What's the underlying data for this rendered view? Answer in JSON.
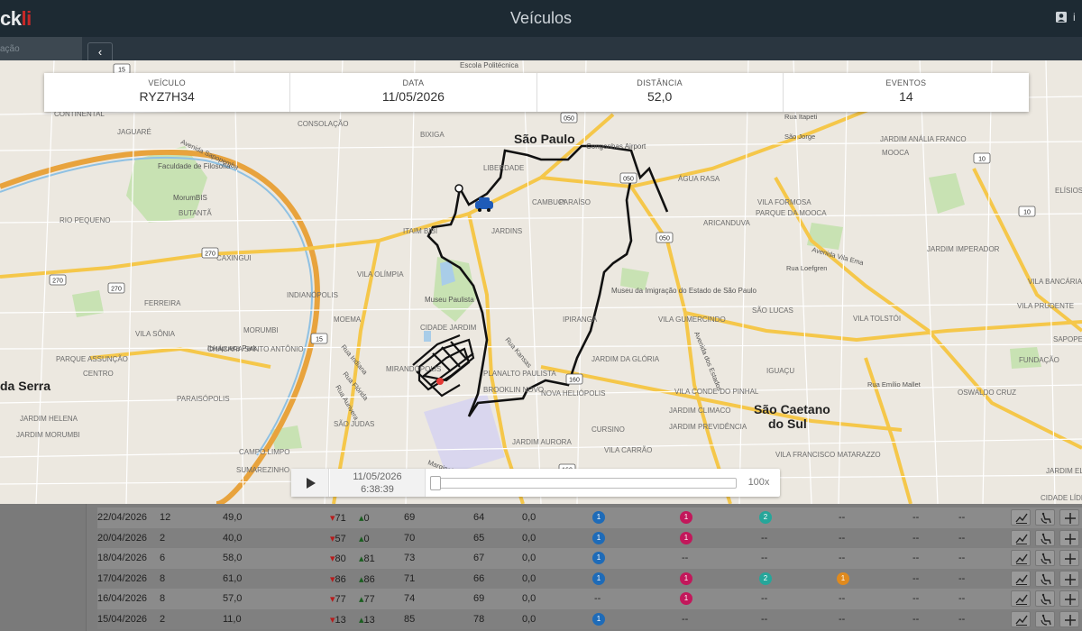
{
  "app": {
    "logo_prefix": "ck",
    "logo_accent": "li",
    "title": "Veículos",
    "user": "i"
  },
  "sidebar": {
    "search_placeholder": "ação"
  },
  "info": [
    {
      "label": "Veículo",
      "value": "RYZ7H34"
    },
    {
      "label": "Data",
      "value": "11/05/2026"
    },
    {
      "label": "Distância",
      "value": "52,0"
    },
    {
      "label": "Eventos",
      "value": "14"
    }
  ],
  "playback": {
    "date": "11/05/2026",
    "time": "6:38:39",
    "speed": "100x",
    "progress": 0
  },
  "map": {
    "labels": [
      {
        "t": "São Paulo",
        "k": "city"
      },
      {
        "t": "São Caetano",
        "k": "city"
      },
      {
        "t": "do Sul",
        "k": "city"
      },
      {
        "t": "da Serra",
        "k": "city"
      },
      {
        "t": "CONTINENTAL",
        "k": "d"
      },
      {
        "t": "JAGUARÉ",
        "k": "d"
      },
      {
        "t": "RIO PEQUENO",
        "k": "d"
      },
      {
        "t": "CAXINGUI",
        "k": "d"
      },
      {
        "t": "BUTANTÃ",
        "k": "d"
      },
      {
        "t": "FERREIRA",
        "k": "d"
      },
      {
        "t": "VILA SÔNIA",
        "k": "d"
      },
      {
        "t": "PARQUE ASSUNÇÃO",
        "k": "d"
      },
      {
        "t": "CENTRO",
        "k": "d"
      },
      {
        "t": "PARAISÓPOLIS",
        "k": "d"
      },
      {
        "t": "JARDIM HELENA",
        "k": "d"
      },
      {
        "t": "JARDIM MORUMBI",
        "k": "d"
      },
      {
        "t": "MORUMBI",
        "k": "d"
      },
      {
        "t": "CHÁCARA SANTO ANTÔNIO",
        "k": "d"
      },
      {
        "t": "CAMPO LIMPO",
        "k": "d"
      },
      {
        "t": "SUMAREZINHO",
        "k": "d"
      },
      {
        "t": "CONSOLAÇÃO",
        "k": "d"
      },
      {
        "t": "BIXIGA",
        "k": "d"
      },
      {
        "t": "LIBERDADE",
        "k": "d"
      },
      {
        "t": "CAMBUCI",
        "k": "d"
      },
      {
        "t": "PARAÍSO",
        "k": "d"
      },
      {
        "t": "JARDINS",
        "k": "d"
      },
      {
        "t": "ITAIM BIBI",
        "k": "d"
      },
      {
        "t": "VILA OLÍMPIA",
        "k": "d"
      },
      {
        "t": "MOEMA",
        "k": "d"
      },
      {
        "t": "CIDADE JARDIM",
        "k": "d"
      },
      {
        "t": "INDIANÓPOLIS",
        "k": "d"
      },
      {
        "t": "MIRANDÓPOLIS",
        "k": "d"
      },
      {
        "t": "PLANALTO PAULISTA",
        "k": "d"
      },
      {
        "t": "BROOKLIN NOVO",
        "k": "d"
      },
      {
        "t": "SÃO JUDAS",
        "k": "d"
      },
      {
        "t": "JARDIM AURORA",
        "k": "d"
      },
      {
        "t": "IPIRANGA",
        "k": "d"
      },
      {
        "t": "VILA GUMERCINDO",
        "k": "d"
      },
      {
        "t": "JARDIM DA GLÓRIA",
        "k": "d"
      },
      {
        "t": "NOVA HELIÓPOLIS",
        "k": "d"
      },
      {
        "t": "VILA CONDE DO PINHAL",
        "k": "d"
      },
      {
        "t": "JARDIM CLIMACO",
        "k": "d"
      },
      {
        "t": "JARDIM PREVIDÊNCIA",
        "k": "d"
      },
      {
        "t": "CURSINO",
        "k": "d"
      },
      {
        "t": "VILA CARRÃO",
        "k": "d"
      },
      {
        "t": "JARDIM ANÁLIA FRANCO",
        "k": "d"
      },
      {
        "t": "MOOCA",
        "k": "d"
      },
      {
        "t": "ÁGUA RASA",
        "k": "d"
      },
      {
        "t": "VILA FORMOSA",
        "k": "d"
      },
      {
        "t": "PARQUE DA MOOCA",
        "k": "d"
      },
      {
        "t": "ARICANDUVA",
        "k": "d"
      },
      {
        "t": "JARDIM IMPERADOR",
        "k": "d"
      },
      {
        "t": "VILA BANCÁRIA",
        "k": "d"
      },
      {
        "t": "VILA PRUDENTE",
        "k": "d"
      },
      {
        "t": "SÃO LUCAS",
        "k": "d"
      },
      {
        "t": "VILA TOLSTÓI",
        "k": "d"
      },
      {
        "t": "SAPOPEMBA",
        "k": "d"
      },
      {
        "t": "FUNDAÇÃO",
        "k": "d"
      },
      {
        "t": "IGUAÇU",
        "k": "d"
      },
      {
        "t": "OSWALDO CRUZ",
        "k": "d"
      },
      {
        "t": "VILA FRANCISCO MATARAZZO",
        "k": "d"
      },
      {
        "t": "JARDIM ELBA",
        "k": "d"
      },
      {
        "t": "CIDADE LÍDER",
        "k": "d"
      },
      {
        "t": "ELÍSIOS",
        "k": "d"
      },
      {
        "t": "Escola Politécnica",
        "k": "p"
      },
      {
        "t": "Faculdade de Filosofia",
        "k": "p"
      },
      {
        "t": "MorumBIS",
        "k": "p"
      },
      {
        "t": "Ibirapuera Park",
        "k": "p"
      },
      {
        "t": "Museu Paulista",
        "k": "p"
      },
      {
        "t": "Museu da Imigração do Estado de São Paulo",
        "k": "p"
      },
      {
        "t": "Congonhas Airport",
        "k": "p"
      },
      {
        "t": "Marginal Pinheiros",
        "k": "r"
      },
      {
        "t": "Avenida Sapopemba",
        "k": "r"
      },
      {
        "t": "Avenida Vila Ema",
        "k": "r"
      },
      {
        "t": "Rua Loefgren",
        "k": "r"
      },
      {
        "t": "Rua Kansas",
        "k": "r"
      },
      {
        "t": "Rua Indiana",
        "k": "r"
      },
      {
        "t": "Rua Flórida",
        "k": "r"
      },
      {
        "t": "Rua Aurivera",
        "k": "r"
      },
      {
        "t": "Avenida dos Estados",
        "k": "r"
      },
      {
        "t": "Rua Emílio Mallet",
        "k": "r"
      },
      {
        "t": "Rua Itapeti",
        "k": "r"
      },
      {
        "t": "São Jorge",
        "k": "r"
      }
    ],
    "shields": [
      "15",
      "270",
      "270",
      "270",
      "15",
      "050",
      "050",
      "050",
      "10",
      "10",
      "160",
      "160"
    ]
  },
  "table": {
    "rows": [
      {
        "date": "22/04/2026",
        "n": "12",
        "dist": "49,0",
        "down": "71",
        "up": "0",
        "a": "69",
        "b": "64",
        "c": "0,0",
        "badges": [
          {
            "v": "1",
            "color": "#1e6bb8"
          },
          {
            "v": "1",
            "color": "#c2185b"
          },
          {
            "v": "2",
            "color": "#26a69a"
          },
          null
        ]
      },
      {
        "date": "20/04/2026",
        "n": "2",
        "dist": "40,0",
        "down": "57",
        "up": "0",
        "a": "70",
        "b": "65",
        "c": "0,0",
        "badges": [
          {
            "v": "1",
            "color": "#1e6bb8"
          },
          {
            "v": "1",
            "color": "#c2185b"
          },
          null,
          null
        ]
      },
      {
        "date": "18/04/2026",
        "n": "6",
        "dist": "58,0",
        "down": "80",
        "up": "81",
        "a": "73",
        "b": "67",
        "c": "0,0",
        "badges": [
          {
            "v": "1",
            "color": "#1e6bb8"
          },
          null,
          null,
          null
        ]
      },
      {
        "date": "17/04/2026",
        "n": "8",
        "dist": "61,0",
        "down": "86",
        "up": "86",
        "a": "71",
        "b": "66",
        "c": "0,0",
        "badges": [
          {
            "v": "1",
            "color": "#1e6bb8"
          },
          {
            "v": "1",
            "color": "#c2185b"
          },
          {
            "v": "2",
            "color": "#26a69a"
          },
          {
            "v": "1",
            "color": "#e08a1e"
          }
        ]
      },
      {
        "date": "16/04/2026",
        "n": "8",
        "dist": "57,0",
        "down": "77",
        "up": "77",
        "a": "74",
        "b": "69",
        "c": "0,0",
        "badges": [
          null,
          {
            "v": "1",
            "color": "#c2185b"
          },
          null,
          null
        ]
      },
      {
        "date": "15/04/2026",
        "n": "2",
        "dist": "11,0",
        "down": "13",
        "up": "13",
        "a": "85",
        "b": "78",
        "c": "0,0",
        "badges": [
          {
            "v": "1",
            "color": "#1e6bb8"
          },
          null,
          null,
          null
        ]
      }
    ],
    "empty_mark": "--",
    "alt_empty_mark": "--"
  }
}
